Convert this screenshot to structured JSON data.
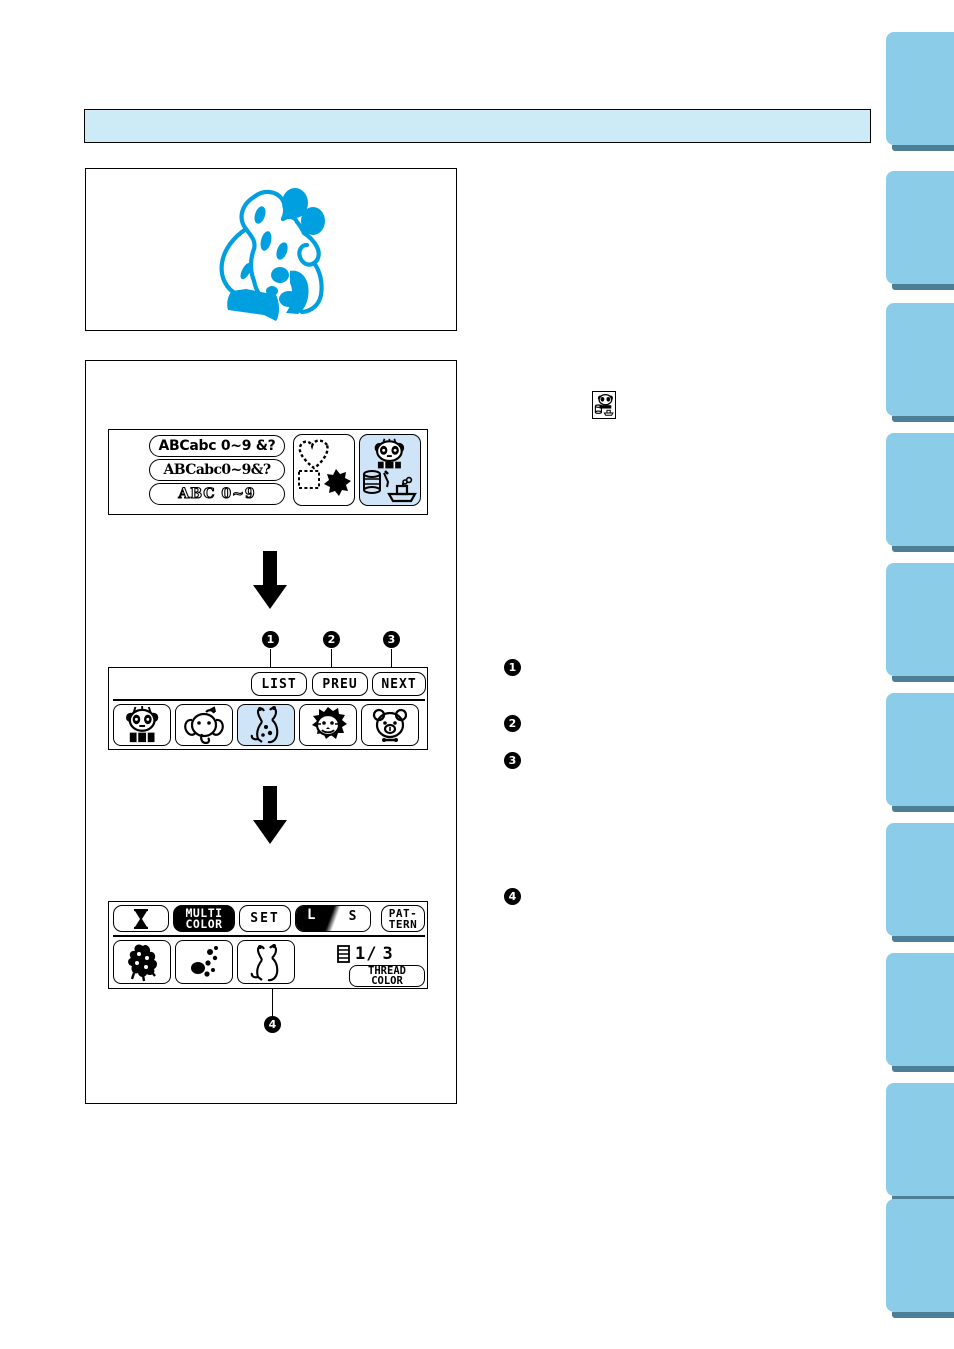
{
  "header": {
    "title": ""
  },
  "illustration": {
    "name": "giraffe-embroidery-artwork",
    "color": "#00a0e0"
  },
  "flow": {
    "arrow1": "down-arrow",
    "arrow2": "down-arrow",
    "screen1": {
      "name": "category-selection-screen",
      "font_keys": [
        {
          "label": "ABCabc 0~9 &?",
          "style": "sans-bold"
        },
        {
          "label": "ABCabc0~9&?",
          "style": "serif-bold"
        },
        {
          "label": "ABC 0~9",
          "style": "outline"
        }
      ],
      "category_keys": [
        {
          "name": "frame-shapes-category",
          "selected": false,
          "icons": [
            "heart",
            "square",
            "gear-flower"
          ]
        },
        {
          "name": "character-patterns-category",
          "selected": true,
          "icons": [
            "panda",
            "thread-spool",
            "boat"
          ]
        }
      ]
    },
    "screen2": {
      "name": "pattern-list-screen",
      "top_keys": [
        {
          "id": "list",
          "label": "LIST"
        },
        {
          "id": "prev",
          "label": "PREU"
        },
        {
          "id": "next",
          "label": "NEXT"
        }
      ],
      "pattern_keys": [
        {
          "name": "panda-pattern",
          "selected": false
        },
        {
          "name": "elephant-pattern",
          "selected": false
        },
        {
          "name": "giraffe-pattern",
          "selected": true
        },
        {
          "name": "lion-pattern",
          "selected": false
        },
        {
          "name": "bear-pattern",
          "selected": false
        }
      ],
      "callouts": [
        {
          "num": "1",
          "target": "list"
        },
        {
          "num": "2",
          "target": "prev"
        },
        {
          "num": "3",
          "target": "next"
        }
      ]
    },
    "screen3": {
      "name": "embroidery-edit-screen",
      "top_keys": [
        {
          "id": "hourglass",
          "label": "",
          "icon": "hourglass-icon",
          "inverted": false
        },
        {
          "id": "multicolor",
          "label": "MULTI\nCOLOR",
          "line1": "MULTI",
          "line2": "COLOR",
          "inverted": true
        },
        {
          "id": "set",
          "label": "SET",
          "inverted": false
        },
        {
          "id": "size",
          "label_l": "L",
          "label_s": "S",
          "selected": "L"
        },
        {
          "id": "pattern",
          "line1": "PAT-",
          "line2": "TERN"
        }
      ],
      "color_steps": [
        {
          "name": "thread-step-1"
        },
        {
          "name": "thread-step-2"
        },
        {
          "name": "thread-step-3"
        }
      ],
      "counter": {
        "icon": "spool-icon",
        "current": "1/",
        "total": "3"
      },
      "thread_color_key": {
        "line1": "THREAD",
        "line2": "COLOR"
      },
      "callouts": [
        {
          "num": "4",
          "target": "thread-step-3"
        }
      ]
    }
  },
  "right_column": {
    "inline_icon": "character-patterns-category-icon",
    "bullets": [
      {
        "num": "1",
        "text": ""
      },
      {
        "num": "2",
        "text": ""
      },
      {
        "num": "3",
        "text": ""
      },
      {
        "num": "4",
        "text": ""
      }
    ]
  },
  "side_tabs": [
    {
      "label": ""
    },
    {
      "label": ""
    },
    {
      "label": ""
    },
    {
      "label": ""
    },
    {
      "label": ""
    },
    {
      "label": ""
    },
    {
      "label": ""
    },
    {
      "label": ""
    },
    {
      "label": ""
    },
    {
      "label": ""
    }
  ]
}
